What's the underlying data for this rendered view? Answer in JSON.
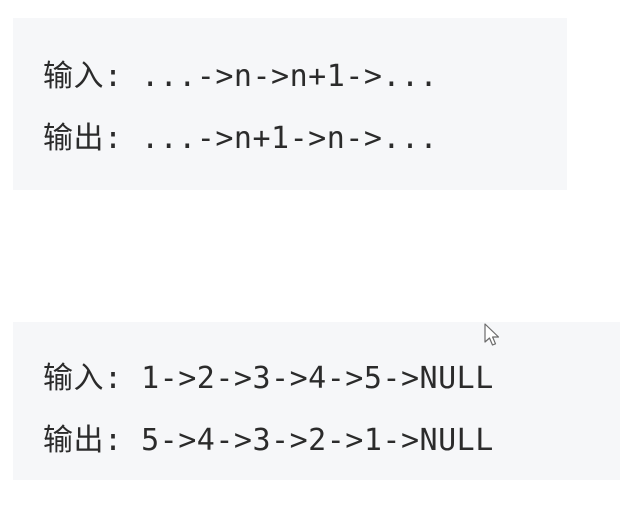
{
  "example_general": {
    "input_line": "输入: ...->n->n+1->...",
    "output_line": "输出: ...->n+1->n->..."
  },
  "example_concrete": {
    "input_line": "输入: 1->2->3->4->5->NULL",
    "output_line": "输出: 5->4->3->2->1->NULL"
  },
  "icons": {
    "cursor": "mouse-pointer-icon"
  }
}
